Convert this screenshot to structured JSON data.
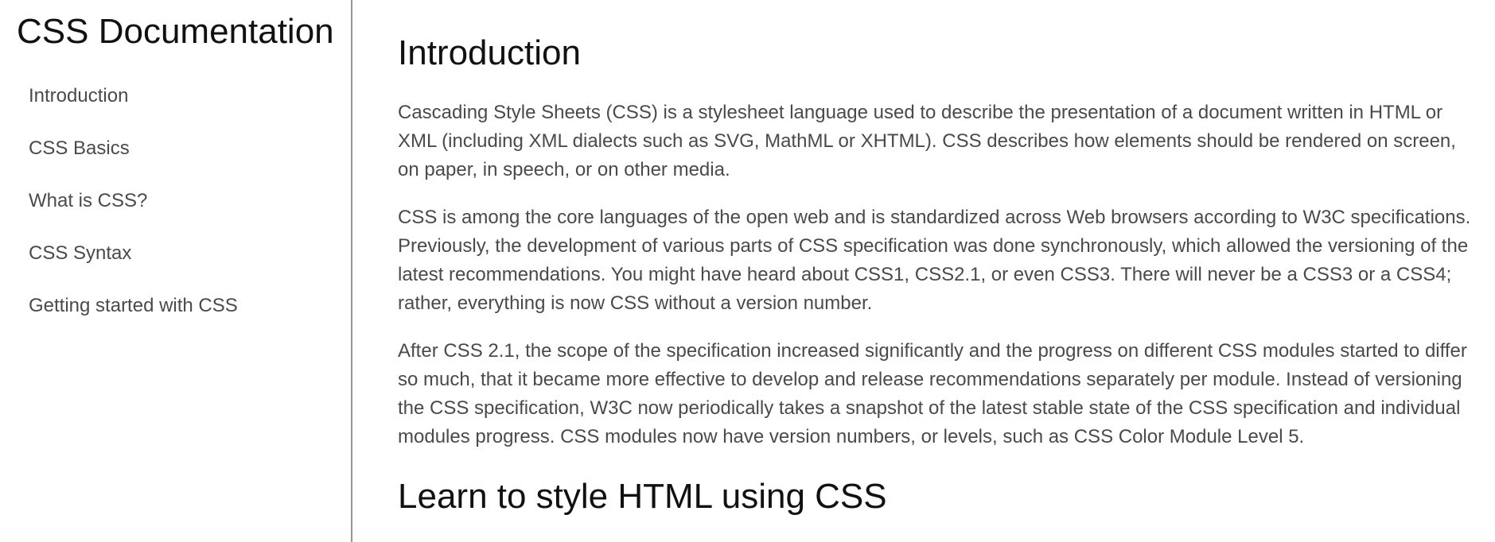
{
  "sidebar": {
    "title": "CSS Documentation",
    "items": [
      {
        "label": "Introduction"
      },
      {
        "label": "CSS Basics"
      },
      {
        "label": "What is CSS?"
      },
      {
        "label": "CSS Syntax"
      },
      {
        "label": "Getting started with CSS"
      }
    ]
  },
  "main": {
    "section1": {
      "heading": "Introduction",
      "paragraphs": [
        "Cascading Style Sheets (CSS) is a stylesheet language used to describe the presentation of a document written in HTML or XML (including XML dialects such as SVG, MathML or XHTML). CSS describes how elements should be rendered on screen, on paper, in speech, or on other media.",
        "CSS is among the core languages of the open web and is standardized across Web browsers according to W3C specifications. Previously, the development of various parts of CSS specification was done synchronously, which allowed the versioning of the latest recommendations. You might have heard about CSS1, CSS2.1, or even CSS3. There will never be a CSS3 or a CSS4; rather, everything is now CSS without a version number.",
        "After CSS 2.1, the scope of the specification increased significantly and the progress on different CSS modules started to differ so much, that it became more effective to develop and release recommendations separately per module. Instead of versioning the CSS specification, W3C now periodically takes a snapshot of the latest stable state of the CSS specification and individual modules progress. CSS modules now have version numbers, or levels, such as CSS Color Module Level 5."
      ]
    },
    "section2": {
      "heading": "Learn to style HTML using CSS"
    }
  }
}
